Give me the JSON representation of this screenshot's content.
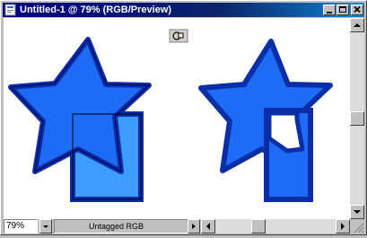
{
  "window": {
    "title": "Untitled-1 @ 79% (RGB/Preview)",
    "title_icon": "photoshop-document-icon",
    "caption_buttons": [
      "minimize-icon",
      "maximize-icon",
      "close-icon"
    ]
  },
  "canvas": {
    "background": "#ffffff",
    "fill_color": "#1e6cf5",
    "light_fill_color": "#3c9cff",
    "outline_color": "#0a2ea8",
    "overlay_icon": "layer-mask-icon"
  },
  "status_bar": {
    "zoom": "79%",
    "profile": "Untagged RGB"
  },
  "colors": {
    "title_bar": "#000080",
    "chrome": "#c0c0c0"
  }
}
